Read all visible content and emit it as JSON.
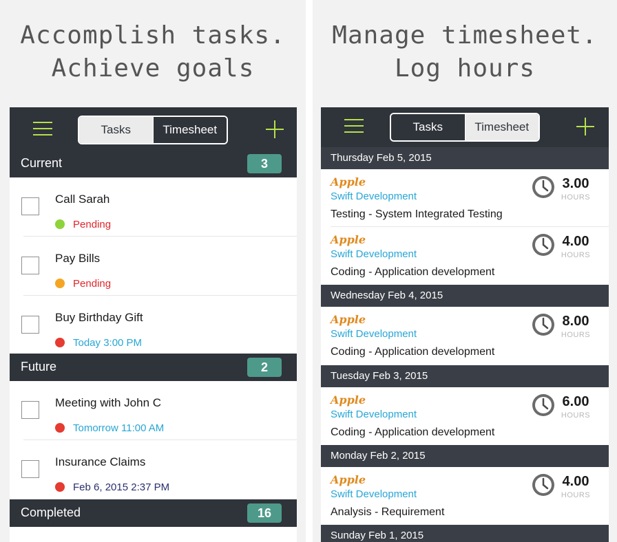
{
  "left": {
    "headline": [
      "Accomplish tasks.",
      "Achieve goals"
    ],
    "seg_tasks": "Tasks",
    "seg_timesheet": "Timesheet",
    "sections": [
      {
        "title": "Current",
        "count": "3"
      },
      {
        "title": "Future",
        "count": "2"
      },
      {
        "title": "Completed",
        "count": "16"
      }
    ],
    "tasks": [
      {
        "name": "Call Sarah",
        "status": "Pending",
        "dot": "#8ed33a",
        "status_color": "#e0262b"
      },
      {
        "name": "Pay Bills",
        "status": "Pending",
        "dot": "#f4a623",
        "status_color": "#e0262b"
      },
      {
        "name": "Buy Birthday Gift",
        "status": "Today 3:00 PM",
        "dot": "#e53b30",
        "status_color": "#27a6d6"
      },
      {
        "name": "Meeting with John C",
        "status": "Tomorrow 11:00 AM",
        "dot": "#e53b30",
        "status_color": "#27a6d6"
      },
      {
        "name": "Insurance Claims",
        "status": "Feb 6, 2015 2:37 PM",
        "dot": "#e53b30",
        "status_color": "#2a2f6e"
      }
    ]
  },
  "right": {
    "headline": [
      "Manage timesheet.",
      "Log hours"
    ],
    "seg_tasks": "Tasks",
    "seg_timesheet": "Timesheet",
    "hours_label": "HOURS",
    "days": [
      "Thursday Feb 5, 2015",
      "Wednesday Feb 4, 2015",
      "Tuesday Feb 3, 2015",
      "Monday Feb 2, 2015",
      "Sunday Feb 1, 2015"
    ],
    "entries": [
      {
        "client": "Apple",
        "project": "Swift Development",
        "desc": "Testing - System Integrated Testing",
        "hours": "3.00"
      },
      {
        "client": "Apple",
        "project": "Swift Development",
        "desc": "Coding - Application development",
        "hours": "4.00"
      },
      {
        "client": "Apple",
        "project": "Swift Development",
        "desc": "Coding - Application development",
        "hours": "8.00"
      },
      {
        "client": "Apple",
        "project": "Swift Development",
        "desc": "Coding - Application development",
        "hours": "6.00"
      },
      {
        "client": "Apple",
        "project": "Swift Development",
        "desc": "Analysis - Requirement",
        "hours": "4.00"
      }
    ]
  },
  "colors": {
    "navbar": "#2f333a",
    "accent_green": "#b5e14a",
    "badge_teal": "#4e9a8a",
    "client_orange": "#e08a1e",
    "project_blue": "#27a6d6"
  },
  "icons": {
    "menu": "hamburger-icon",
    "add": "plus-icon",
    "clock": "clock-icon"
  }
}
